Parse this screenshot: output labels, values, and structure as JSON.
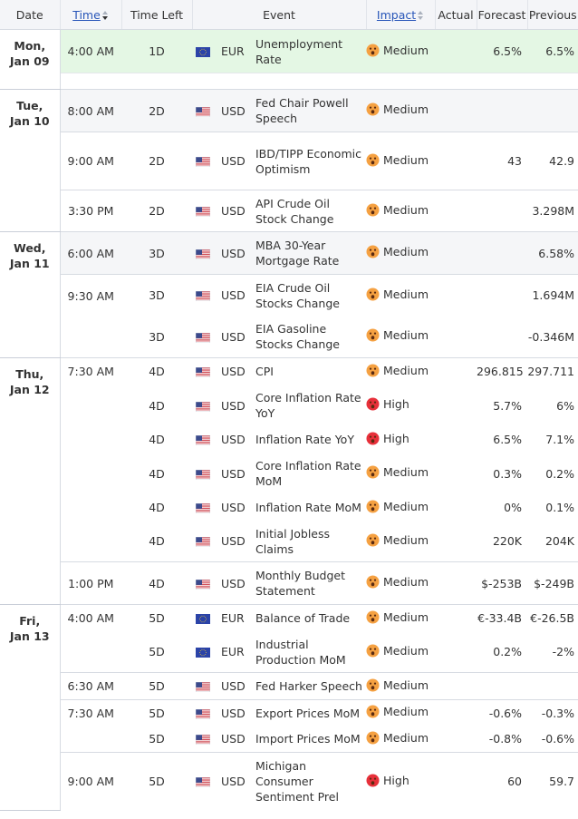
{
  "headers": {
    "date": "Date",
    "time": "Time",
    "time_left": "Time Left",
    "event": "Event",
    "impact": "Impact",
    "actual": "Actual",
    "forecast": "Forecast",
    "previous": "Previous"
  },
  "colors": {
    "medium": "#f5a142",
    "high": "#e7303a",
    "highlight": "#e4f7e4"
  },
  "days": [
    {
      "date_line1": "Mon,",
      "date_line2": "Jan 09",
      "rows": [
        {
          "time": "4:00 AM",
          "time_left": "1D",
          "flag": "eu-flag-icon",
          "currency": "EUR",
          "event": "Unemployment Rate",
          "impact": "Medium",
          "impact_icon": "medium-impact-icon",
          "actual": "",
          "forecast": "6.5%",
          "previous": "6.5%"
        }
      ]
    },
    {
      "date_line1": "Tue,",
      "date_line2": "Jan 10",
      "rows": [
        {
          "time": "8:00 AM",
          "time_left": "2D",
          "flag": "us-flag-icon",
          "currency": "USD",
          "event": "Fed Chair Powell Speech",
          "impact": "Medium",
          "impact_icon": "medium-impact-icon",
          "actual": "",
          "forecast": "",
          "previous": ""
        },
        {
          "time": "9:00 AM",
          "time_left": "2D",
          "flag": "us-flag-icon",
          "currency": "USD",
          "event": "IBD/TIPP Economic Optimism",
          "impact": "Medium",
          "impact_icon": "medium-impact-icon",
          "actual": "",
          "forecast": "43",
          "previous": "42.9"
        },
        {
          "time": "3:30 PM",
          "time_left": "2D",
          "flag": "us-flag-icon",
          "currency": "USD",
          "event": "API Crude Oil Stock Change",
          "impact": "Medium",
          "impact_icon": "medium-impact-icon",
          "actual": "",
          "forecast": "",
          "previous": "3.298M"
        }
      ]
    },
    {
      "date_line1": "Wed,",
      "date_line2": "Jan 11",
      "rows": [
        {
          "time": "6:00 AM",
          "time_left": "3D",
          "flag": "us-flag-icon",
          "currency": "USD",
          "event": "MBA 30-Year Mortgage Rate",
          "impact": "Medium",
          "impact_icon": "medium-impact-icon",
          "actual": "",
          "forecast": "",
          "previous": "6.58%"
        },
        {
          "time": "9:30 AM",
          "time_left": "3D",
          "flag": "us-flag-icon",
          "currency": "USD",
          "event": "EIA Crude Oil Stocks Change",
          "impact": "Medium",
          "impact_icon": "medium-impact-icon",
          "actual": "",
          "forecast": "",
          "previous": "1.694M"
        },
        {
          "time": "",
          "time_left": "3D",
          "flag": "us-flag-icon",
          "currency": "USD",
          "event": "EIA Gasoline Stocks Change",
          "impact": "Medium",
          "impact_icon": "medium-impact-icon",
          "actual": "",
          "forecast": "",
          "previous": "-0.346M"
        }
      ]
    },
    {
      "date_line1": "Thu,",
      "date_line2": "Jan 12",
      "rows": [
        {
          "time": "7:30 AM",
          "time_left": "4D",
          "flag": "us-flag-icon",
          "currency": "USD",
          "event": "CPI",
          "impact": "Medium",
          "impact_icon": "medium-impact-icon",
          "actual": "",
          "forecast": "296.815",
          "previous": "297.711"
        },
        {
          "time": "",
          "time_left": "4D",
          "flag": "us-flag-icon",
          "currency": "USD",
          "event": "Core Inflation Rate YoY",
          "impact": "High",
          "impact_icon": "high-impact-icon",
          "actual": "",
          "forecast": "5.7%",
          "previous": "6%"
        },
        {
          "time": "",
          "time_left": "4D",
          "flag": "us-flag-icon",
          "currency": "USD",
          "event": "Inflation Rate YoY",
          "impact": "High",
          "impact_icon": "high-impact-icon",
          "actual": "",
          "forecast": "6.5%",
          "previous": "7.1%"
        },
        {
          "time": "",
          "time_left": "4D",
          "flag": "us-flag-icon",
          "currency": "USD",
          "event": "Core Inflation Rate MoM",
          "impact": "Medium",
          "impact_icon": "medium-impact-icon",
          "actual": "",
          "forecast": "0.3%",
          "previous": "0.2%"
        },
        {
          "time": "",
          "time_left": "4D",
          "flag": "us-flag-icon",
          "currency": "USD",
          "event": "Inflation Rate MoM",
          "impact": "Medium",
          "impact_icon": "medium-impact-icon",
          "actual": "",
          "forecast": "0%",
          "previous": "0.1%"
        },
        {
          "time": "",
          "time_left": "4D",
          "flag": "us-flag-icon",
          "currency": "USD",
          "event": "Initial Jobless Claims",
          "impact": "Medium",
          "impact_icon": "medium-impact-icon",
          "actual": "",
          "forecast": "220K",
          "previous": "204K"
        },
        {
          "time": "1:00 PM",
          "time_left": "4D",
          "flag": "us-flag-icon",
          "currency": "USD",
          "event": "Monthly Budget Statement",
          "impact": "Medium",
          "impact_icon": "medium-impact-icon",
          "actual": "",
          "forecast": "$-253B",
          "previous": "$-249B"
        }
      ]
    },
    {
      "date_line1": "Fri,",
      "date_line2": "Jan 13",
      "rows": [
        {
          "time": "4:00 AM",
          "time_left": "5D",
          "flag": "eu-flag-icon",
          "currency": "EUR",
          "event": "Balance of Trade",
          "impact": "Medium",
          "impact_icon": "medium-impact-icon",
          "actual": "",
          "forecast": "€-33.4B",
          "previous": "€-26.5B"
        },
        {
          "time": "",
          "time_left": "5D",
          "flag": "eu-flag-icon",
          "currency": "EUR",
          "event": "Industrial Production MoM",
          "impact": "Medium",
          "impact_icon": "medium-impact-icon",
          "actual": "",
          "forecast": "0.2%",
          "previous": "-2%"
        },
        {
          "time": "6:30 AM",
          "time_left": "5D",
          "flag": "us-flag-icon",
          "currency": "USD",
          "event": "Fed Harker Speech",
          "impact": "Medium",
          "impact_icon": "medium-impact-icon",
          "actual": "",
          "forecast": "",
          "previous": ""
        },
        {
          "time": "7:30 AM",
          "time_left": "5D",
          "flag": "us-flag-icon",
          "currency": "USD",
          "event": "Export Prices MoM",
          "impact": "Medium",
          "impact_icon": "medium-impact-icon",
          "actual": "",
          "forecast": "-0.6%",
          "previous": "-0.3%"
        },
        {
          "time": "",
          "time_left": "5D",
          "flag": "us-flag-icon",
          "currency": "USD",
          "event": "Import Prices MoM",
          "impact": "Medium",
          "impact_icon": "medium-impact-icon",
          "actual": "",
          "forecast": "-0.8%",
          "previous": "-0.6%"
        },
        {
          "time": "9:00 AM",
          "time_left": "5D",
          "flag": "us-flag-icon",
          "currency": "USD",
          "event": "Michigan Consumer Sentiment Prel",
          "impact": "High",
          "impact_icon": "high-impact-icon",
          "actual": "",
          "forecast": "60",
          "previous": "59.7"
        }
      ]
    }
  ]
}
